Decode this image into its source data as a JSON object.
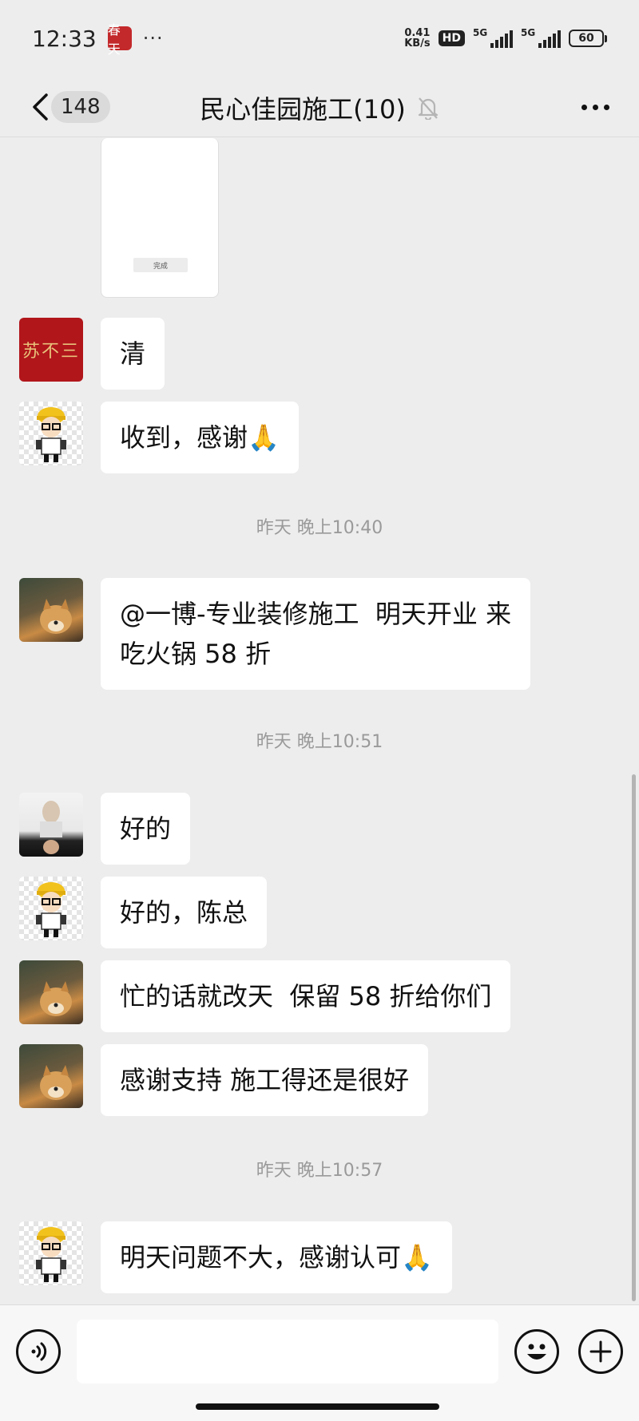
{
  "status_bar": {
    "time": "12:33",
    "app_badge": "春天",
    "dots": "···",
    "net_speed_value": "0.41",
    "net_speed_unit": "KB/s",
    "hd_label": "HD",
    "network_1": "5G",
    "network_2": "5G",
    "battery": "60"
  },
  "nav": {
    "unread_count": "148",
    "title": "民心佳园施工(10)"
  },
  "chat": {
    "image_card_button": "完成",
    "red_avatar_text": "苏不三",
    "messages": [
      {
        "text": "清"
      },
      {
        "text": "收到，感谢🙏"
      },
      {
        "text": "@一博-专业装修施工  明天开业 来\n吃火锅 58 折"
      },
      {
        "text": "好的"
      },
      {
        "text": "好的，陈总"
      },
      {
        "text": "忙的话就改天  保留 58 折给你们"
      },
      {
        "text": "感谢支持 施工得还是很好"
      },
      {
        "text": "明天问题不大，感谢认可🙏"
      }
    ],
    "timestamps": [
      {
        "text": "昨天 晚上10:40"
      },
      {
        "text": "昨天 晚上10:51"
      },
      {
        "text": "昨天 晚上10:57"
      }
    ]
  },
  "input_bar": {
    "placeholder": ""
  },
  "icons": {
    "back": "chevron-left-icon",
    "mute": "bell-off-icon",
    "more": "more-icon",
    "voice": "voice-icon",
    "emoji": "emoji-icon",
    "plus": "plus-icon"
  },
  "colors": {
    "background": "#ededed",
    "bubble": "#ffffff",
    "timestamp": "#9a9a9a"
  }
}
